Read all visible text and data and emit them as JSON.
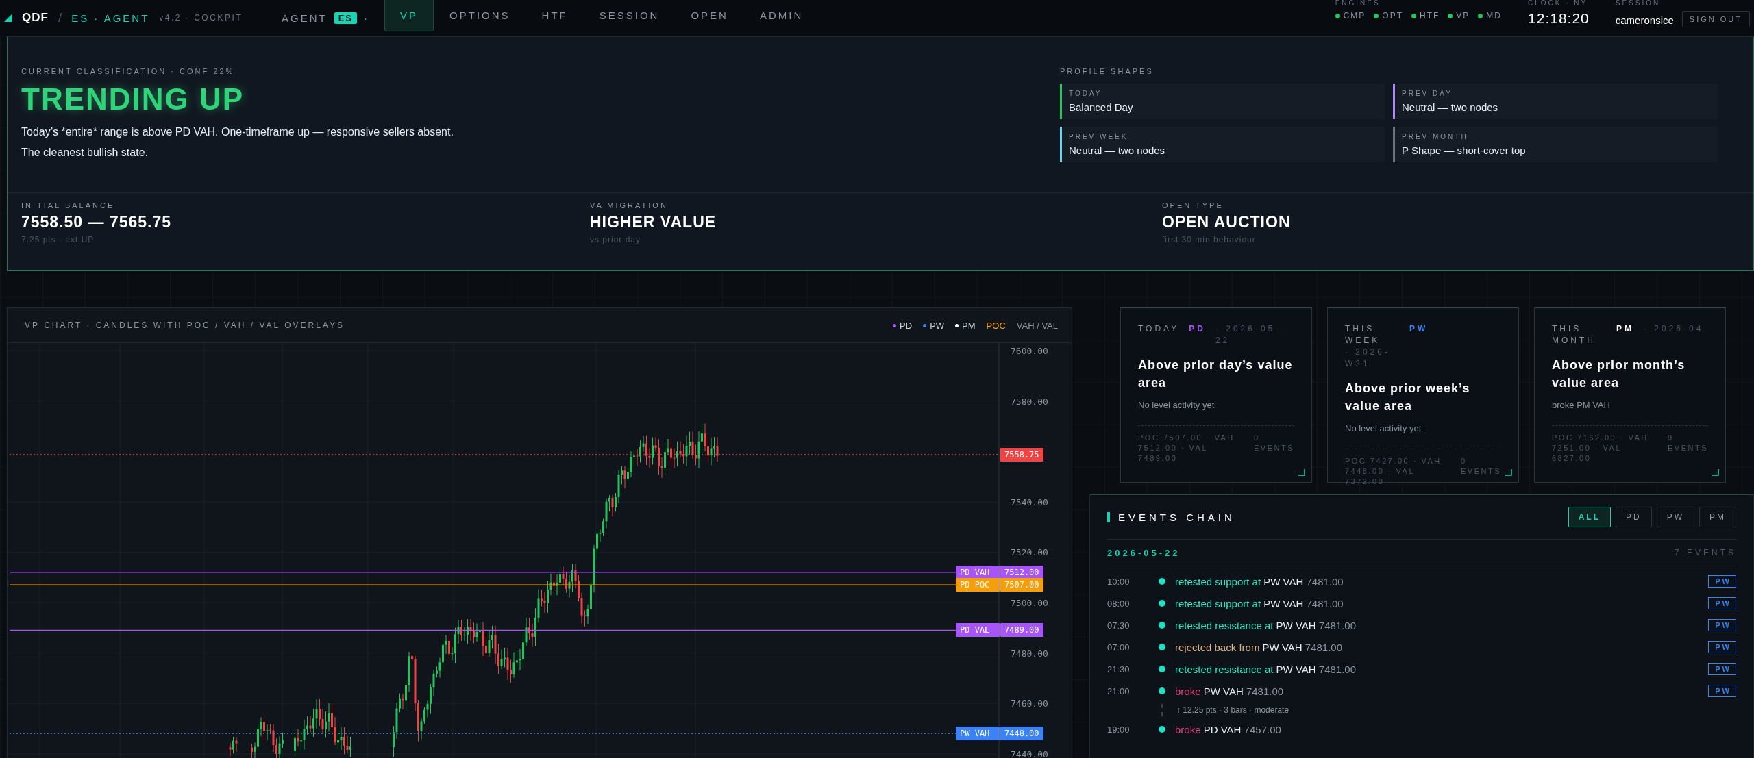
{
  "topbar": {
    "brand": "QDF",
    "separator": "/",
    "product": "ES · AGENT",
    "version": "v4.2 · COCKPIT",
    "agent": {
      "label": "AGENT",
      "badge": "ES",
      "dot": "·"
    },
    "tabs": [
      {
        "label": "VP",
        "selected": true
      },
      {
        "label": "OPTIONS",
        "selected": false
      },
      {
        "label": "HTF",
        "selected": false
      },
      {
        "label": "SESSION",
        "selected": false
      },
      {
        "label": "OPEN",
        "selected": false
      },
      {
        "label": "ADMIN",
        "selected": false
      }
    ],
    "engines": {
      "label": "ENGINES",
      "items": [
        {
          "name": "CMP",
          "on": true
        },
        {
          "name": "OPT",
          "on": true
        },
        {
          "name": "HTF",
          "on": true
        },
        {
          "name": "VP",
          "on": true
        },
        {
          "name": "MD",
          "on": true
        }
      ]
    },
    "clock": {
      "label": "CLOCK · NY",
      "time": "12:18:20"
    },
    "session": {
      "label": "SESSION",
      "user": "cameronsice",
      "sign_out": "SIGN OUT"
    }
  },
  "classification": {
    "label": "CURRENT CLASSIFICATION · CONF 22%",
    "state": "TRENDING UP",
    "description": [
      "Today’s *entire* range is above PD VAH. One-timeframe up — responsive sellers absent.",
      "The cleanest bullish state."
    ],
    "profile_shapes": {
      "title": "PROFILE SHAPES",
      "items": [
        {
          "label": "TODAY",
          "value": "Balanced Day",
          "color": "#22c55e"
        },
        {
          "label": "PREV DAY",
          "value": "Neutral — two nodes",
          "color": "#a78bfa"
        },
        {
          "label": "PREV WEEK",
          "value": "Neutral — two nodes",
          "color": "#67d4f0"
        },
        {
          "label": "PREV MONTH",
          "value": "P Shape — short-cover top",
          "color": "#6b7280"
        }
      ]
    },
    "stats": [
      {
        "label": "INITIAL BALANCE",
        "value": "7558.50 — 7565.75",
        "note": "7.25 pts · ext UP"
      },
      {
        "label": "VA MIGRATION",
        "value": "HIGHER VALUE",
        "note": "vs prior day"
      },
      {
        "label": "OPEN TYPE",
        "value": "OPEN AUCTION",
        "note": "first 30 min behaviour"
      }
    ]
  },
  "chart": {
    "title": "VP CHART · CANDLES WITH POC / VAH / VAL OVERLAYS",
    "legend": [
      {
        "label": "PD",
        "color": "#a855f7",
        "kind": "dot"
      },
      {
        "label": "PW",
        "color": "#3b82f6",
        "kind": "dot"
      },
      {
        "label": "PM",
        "color": "#ffffff",
        "kind": "dot"
      },
      {
        "label": "POC",
        "color": "#f59e0b",
        "kind": "text"
      },
      {
        "label": "VAH / VAL",
        "color": "#8b949e",
        "kind": "text"
      }
    ],
    "y_axis": [
      "7600.00",
      "7580.00",
      "7540.00",
      "7520.00",
      "7500.00",
      "7480.00",
      "7460.00",
      "7440.00"
    ],
    "last_price": "7558.75",
    "levels": [
      {
        "label": "PD VAH",
        "value": "7512.00",
        "color": "#a855f7",
        "dashed": false
      },
      {
        "label": "PD POC",
        "value": "7507.00",
        "color": "#f59e0b",
        "dashed": false
      },
      {
        "label": "PD VAL",
        "value": "7489.00",
        "color": "#a855f7",
        "dashed": false
      },
      {
        "label": "PW VAH",
        "value": "7448.00",
        "color": "#3b82f6",
        "dashed": true
      }
    ]
  },
  "cards": [
    {
      "period": "TODAY",
      "tag": "PD",
      "color": "#a855f7",
      "date": "· 2026-05-22",
      "headline": "Above prior day’s value area",
      "status": "No level activity yet",
      "stats": "POC 7507.00 · VAH 7512.00 · VAL 7489.00",
      "events": "0 EVENTS"
    },
    {
      "period": "THIS WEEK",
      "tag": "PW",
      "color": "#3b82f6",
      "date": "· 2026-W21",
      "headline": "Above prior week’s value area",
      "status": "No level activity yet",
      "stats": "POC 7427.00 · VAH 7448.00 · VAL 7372.00",
      "events": "0 EVENTS"
    },
    {
      "period": "THIS MONTH",
      "tag": "PM",
      "color": "#ffffff",
      "date": "· 2026-04",
      "headline": "Above prior month’s value area",
      "status": "broke PM VAH",
      "stats": "POC 7162.00 · VAH 7251.00 · VAL 6827.00",
      "events": "9 EVENTS"
    }
  ],
  "events": {
    "title": "EVENTS CHAIN",
    "filters": [
      {
        "label": "ALL",
        "selected": true
      },
      {
        "label": "PD",
        "selected": false
      },
      {
        "label": "PW",
        "selected": false
      },
      {
        "label": "PM",
        "selected": false
      }
    ],
    "date": "2026-05-22",
    "count": "7 EVENTS",
    "items": [
      {
        "time": "10:00",
        "kind": "retest",
        "action": "retested support at",
        "level": "PW VAH",
        "price": "7481.00",
        "tag": "PW"
      },
      {
        "time": "08:00",
        "kind": "retest",
        "action": "retested support at",
        "level": "PW VAH",
        "price": "7481.00",
        "tag": "PW"
      },
      {
        "time": "07:30",
        "kind": "retest",
        "action": "retested resistance at",
        "level": "PW VAH",
        "price": "7481.00",
        "tag": "PW"
      },
      {
        "time": "07:00",
        "kind": "reject",
        "action": "rejected back from",
        "level": "PW VAH",
        "price": "7481.00",
        "tag": "PW"
      },
      {
        "time": "21:30",
        "kind": "retest",
        "action": "retested resistance at",
        "level": "PW VAH",
        "price": "7481.00",
        "tag": "PW"
      },
      {
        "time": "21:00",
        "kind": "broke",
        "action": "broke",
        "level": "PW VAH",
        "price": "7481.00",
        "tag": "PW",
        "note": "↑ 12.25 pts · 3 bars · moderate"
      },
      {
        "time": "19:00",
        "kind": "broke",
        "action": "broke",
        "level": "PD VAH",
        "price": "7457.00"
      }
    ]
  }
}
